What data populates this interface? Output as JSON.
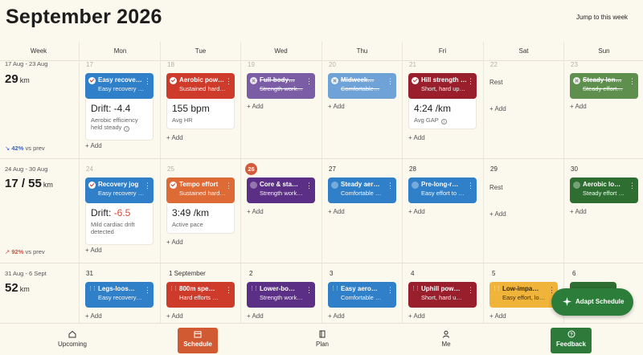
{
  "header": {
    "title": "September 2026",
    "jump_label": "Jump to this week"
  },
  "columns": [
    "Week",
    "Mon",
    "Tue",
    "Wed",
    "Thu",
    "Fri",
    "Sat",
    "Sun"
  ],
  "weeks": [
    {
      "range": "17 Aug - 23 Aug",
      "km": "29",
      "unit": "km",
      "pct": "42%",
      "vs": "vs prev",
      "days": [
        "17",
        "18",
        "19",
        "20",
        "21",
        "22",
        "23"
      ]
    },
    {
      "range": "24 Aug - 30 Aug",
      "km": "17 / 55",
      "unit": "km",
      "pct": "92%",
      "vs": "vs prev",
      "days": [
        "24",
        "25",
        "26",
        "27",
        "28",
        "29",
        "30"
      ]
    },
    {
      "range": "31 Aug - 6 Sept",
      "km": "52",
      "unit": "km",
      "days": [
        "31",
        "1 September",
        "2",
        "3",
        "4",
        "5",
        "6"
      ]
    }
  ],
  "add_label": "+ Add",
  "rest_label": "Rest",
  "cards": {
    "w1_mon": {
      "t1": "Easy recove…",
      "t2": "Easy recovery e…"
    },
    "w1_tue": {
      "t1": "Aerobic pow…",
      "t2": "Sustained hard …"
    },
    "w1_wed": {
      "t1": "Full-body…",
      "t2": "Strength work…"
    },
    "w1_thu": {
      "t1": "Midweek…",
      "t2": "Comfortable…"
    },
    "w1_fri": {
      "t1": "Hill strength …",
      "t2": "Short, hard uphi…"
    },
    "w1_sun": {
      "t1": "Steady lon…",
      "t2": "Steady effort…"
    },
    "w2_mon": {
      "t1": "Recovery jog",
      "t2": "Easy recovery e…"
    },
    "w2_tue": {
      "t1": "Tempo effort",
      "t2": "Sustained hard …"
    },
    "w2_wed": {
      "t1": "Core & sta…",
      "t2": "Strength work…"
    },
    "w2_thu": {
      "t1": "Steady aer…",
      "t2": "Comfortable …"
    },
    "w2_fri": {
      "t1": "Pre-long-r…",
      "t2": "Easy effort to …"
    },
    "w2_sun": {
      "t1": "Aerobic lo…",
      "t2": "Steady effort …"
    },
    "w3_mon": {
      "t1": "Legs-loos…",
      "t2": "Easy recovery…"
    },
    "w3_tue": {
      "t1": "800m spe…",
      "t2": "Hard efforts …"
    },
    "w3_wed": {
      "t1": "Lower-bo…",
      "t2": "Strength work…"
    },
    "w3_thu": {
      "t1": "Easy aero…",
      "t2": "Comfortable …"
    },
    "w3_fri": {
      "t1": "Uphill pow…",
      "t2": "Short, hard u…"
    },
    "w3_sat": {
      "t1": "Low-impa…",
      "t2": "Easy effort, lo…"
    }
  },
  "metrics": {
    "w1_mon": {
      "value": "Drift: -4.4",
      "label": "Aerobic efficiency held steady"
    },
    "w1_tue": {
      "value": "155 bpm",
      "label": "Avg HR"
    },
    "w1_fri": {
      "value": "4:24 /km",
      "label": "Avg GAP"
    },
    "w2_mon": {
      "prefix": "Drift: ",
      "neg": "-6.5",
      "label": "Mild cardiac drift detected"
    },
    "w2_tue": {
      "value": "3:49 /km",
      "label": "Active pace"
    }
  },
  "colors": {
    "blue": "#2f7fc9",
    "red": "#cf3b2b",
    "purple": "#7b5da6",
    "lightblue": "#6fa2d6",
    "maroon": "#9a1f2c",
    "green": "#5e8f4e",
    "orange": "#de6a35",
    "darkpurple": "#5c2f86",
    "darkgreen": "#2e6f31",
    "amber": "#f0b43a",
    "brand": "#d15a33"
  },
  "nav": {
    "upcoming": "Upcoming",
    "schedule": "Schedule",
    "plan": "Plan",
    "me": "Me",
    "feedback": "Feedback"
  },
  "fab_label": "Adapt Schedule"
}
